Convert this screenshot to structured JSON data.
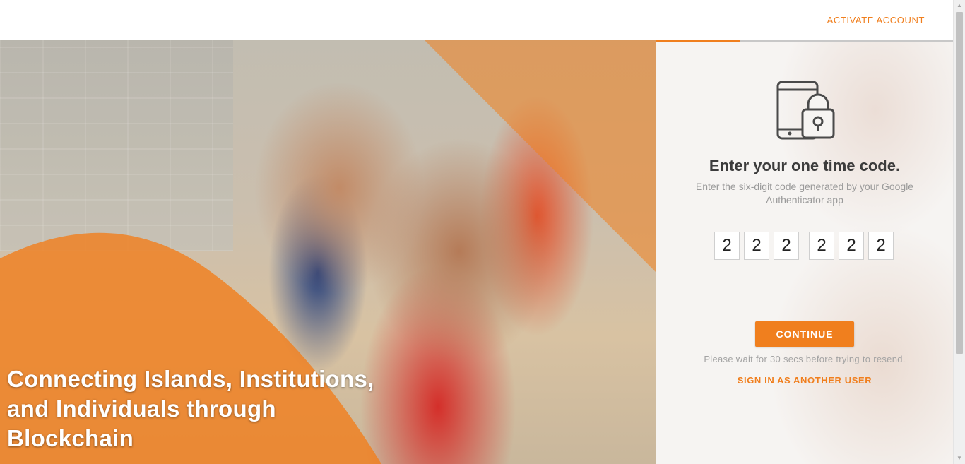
{
  "header": {
    "activate_account_label": "ACTIVATE ACCOUNT"
  },
  "hero": {
    "title": "Connecting Islands, Institutions, and Individuals through Blockchain",
    "accent_color": "#f07f1e"
  },
  "otp": {
    "progress_fraction": 0.28,
    "icon": "phone-lock-icon",
    "title": "Enter your one time code.",
    "subtitle": "Enter the six-digit code generated by your Google Authenticator app",
    "digits": [
      "2",
      "2",
      "2",
      "2",
      "2",
      "2"
    ],
    "continue_label": "CONTINUE",
    "resend_note": "Please wait for 30 secs before trying to resend.",
    "signin_other_label": "SIGN IN AS ANOTHER USER"
  },
  "colors": {
    "accent": "#f07f1e",
    "title_text": "#3c3c3c",
    "muted_text": "#9a9a9a"
  }
}
